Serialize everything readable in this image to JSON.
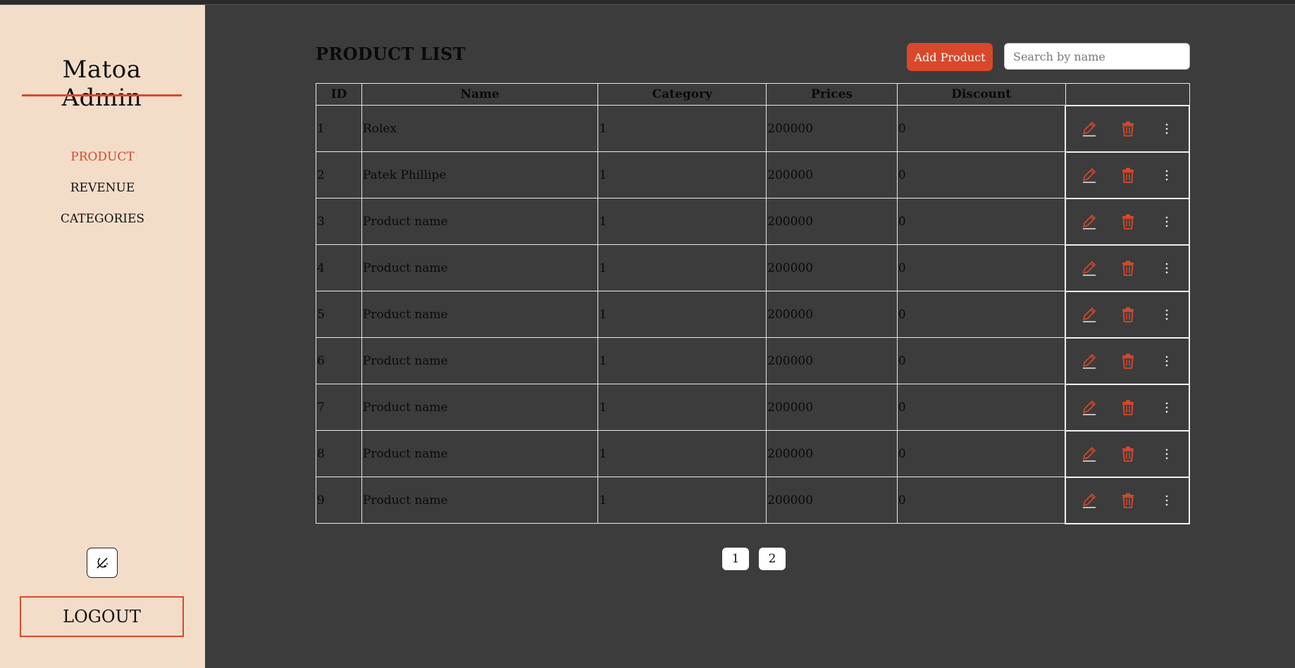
{
  "sidebar": {
    "brand": "Matoa Admin",
    "nav": [
      {
        "label": "PRODUCT",
        "active": true
      },
      {
        "label": "REVENUE",
        "active": false
      },
      {
        "label": "CATEGORIES",
        "active": false
      }
    ],
    "theme_toggle_icon": "theme-toggle-icon",
    "logout_label": "LOGOUT"
  },
  "main": {
    "title": "PRODUCT LIST",
    "add_button_label": "Add Product",
    "search_placeholder": "Search by name",
    "search_value": ""
  },
  "table": {
    "columns": [
      "ID",
      "Name",
      "Category",
      "Prices",
      "Discount",
      ""
    ],
    "rows": [
      {
        "id": "1",
        "name": "Rolex",
        "category": "1",
        "price": "200000",
        "discount": "0"
      },
      {
        "id": "2",
        "name": "Patek Phillipe",
        "category": "1",
        "price": "200000",
        "discount": "0"
      },
      {
        "id": "3",
        "name": "Product name",
        "category": "1",
        "price": "200000",
        "discount": "0"
      },
      {
        "id": "4",
        "name": "Product name",
        "category": "1",
        "price": "200000",
        "discount": "0"
      },
      {
        "id": "5",
        "name": "Product name",
        "category": "1",
        "price": "200000",
        "discount": "0"
      },
      {
        "id": "6",
        "name": "Product name",
        "category": "1",
        "price": "200000",
        "discount": "0"
      },
      {
        "id": "7",
        "name": "Product name",
        "category": "1",
        "price": "200000",
        "discount": "0"
      },
      {
        "id": "8",
        "name": "Product name",
        "category": "1",
        "price": "200000",
        "discount": "0"
      },
      {
        "id": "9",
        "name": "Product name",
        "category": "1",
        "price": "200000",
        "discount": "0"
      }
    ],
    "row_actions": [
      "edit-pencil-icon",
      "delete-trash-icon",
      "more-vertical-icon"
    ]
  },
  "pagination": {
    "pages": [
      "1",
      "2"
    ]
  },
  "colors": {
    "accent": "#d9482b",
    "sidebar_bg": "#f3ddc9",
    "main_bg": "#3c3c3c"
  }
}
